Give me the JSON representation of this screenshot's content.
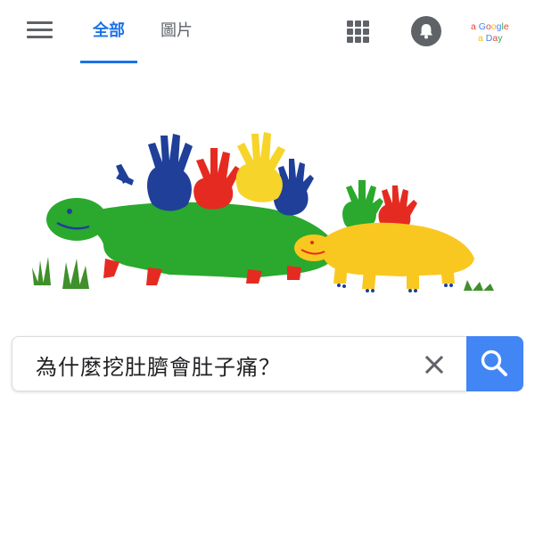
{
  "tabs": {
    "all": "全部",
    "images": "圖片"
  },
  "logo": {
    "line1": "a Google",
    "line2": "a Day",
    "colors": [
      "#4285f4",
      "#ea4335",
      "#fbbc05",
      "#34a853"
    ]
  },
  "search": {
    "query": "為什麼挖肚臍會肚子痛？"
  },
  "icons": {
    "menu": "hamburger-menu-icon",
    "apps": "apps-grid-icon",
    "notifications": "bell-icon",
    "clear": "close-icon",
    "search": "magnifier-icon"
  },
  "colors": {
    "accent": "#1a73e8",
    "search_button": "#4285f4",
    "icon_gray": "#5f6368"
  },
  "doodle": {
    "kind": "handprint-turtles-illustration",
    "palette": [
      "#2aa92e",
      "#f9c820",
      "#1f3f99",
      "#e52b21",
      "#f6d42a",
      "#4b8a2e"
    ]
  }
}
